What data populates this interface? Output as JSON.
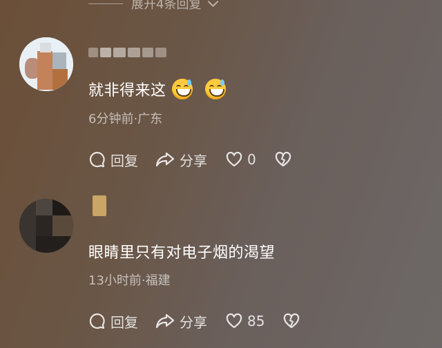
{
  "expand": {
    "label": "展开4条回复"
  },
  "comments": [
    {
      "username": "",
      "text": "就非得来这",
      "emojis": [
        "grin-sweat-emoji",
        "grin-sweat-emoji"
      ],
      "meta": "6分钟前·广东",
      "reply_label": "回复",
      "share_label": "分享",
      "like_count": "0"
    },
    {
      "username": "",
      "text": "眼睛里只有对电子烟的渴望",
      "emojis": [],
      "meta": "13小时前·福建",
      "reply_label": "回复",
      "share_label": "分享",
      "like_count": "85"
    }
  ],
  "colors": {
    "text_primary": "#ffffff",
    "text_secondary": "#c9c1bb",
    "emoji": "#ffcb3d"
  }
}
